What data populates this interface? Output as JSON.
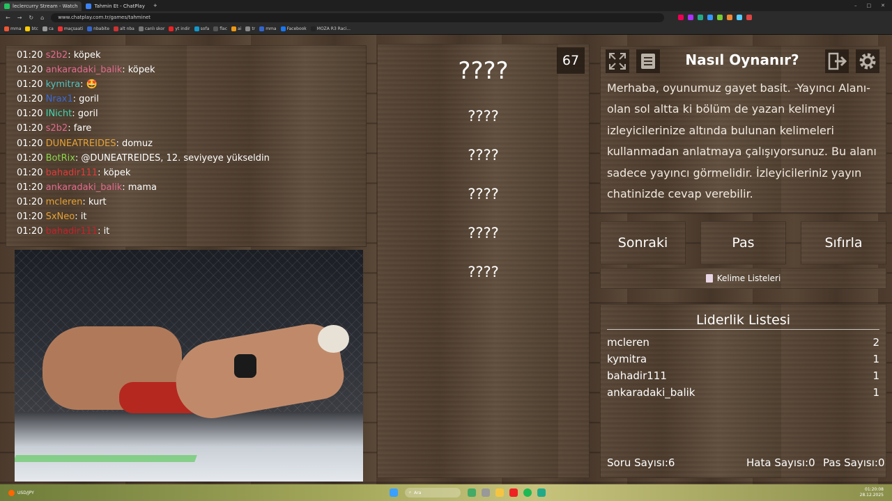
{
  "browser": {
    "tabs": [
      {
        "label": "leclercurry Stream - Watch",
        "active": true,
        "color": "#22c55e"
      },
      {
        "label": "Tahmin Et - ChatPlay",
        "active": false,
        "color": "#3b82f6"
      }
    ],
    "url": "www.chatplay.com.tr/games/tahminet",
    "bookmarks": [
      "mma",
      "btc",
      "ca",
      "maçsaati",
      "nbabite",
      "alt nba",
      "canlı skor",
      "yt indir",
      "sofa",
      "flac",
      "ai",
      "tr",
      "mma",
      "Facebook",
      "MOZA R3 Raci..."
    ]
  },
  "chat": {
    "messages": [
      {
        "time": "01:20",
        "user": "s2b2",
        "color": "#e36b8f",
        "text": ": köpek"
      },
      {
        "time": "01:20",
        "user": "ankaradaki_balik",
        "color": "#e36b8f",
        "text": ": köpek"
      },
      {
        "time": "01:20",
        "user": "kymitra",
        "color": "#4fc3c3",
        "text": ": 🤩"
      },
      {
        "time": "01:20",
        "user": "Nrax1",
        "color": "#3a6ad6",
        "text": ": goril"
      },
      {
        "time": "01:20",
        "user": "INicht",
        "color": "#3fd8b0",
        "text": ": goril"
      },
      {
        "time": "01:20",
        "user": "s2b2",
        "color": "#e36b8f",
        "text": ": fare"
      },
      {
        "time": "01:20",
        "user": "DUNEATREIDES",
        "color": "#e6a236",
        "text": ": domuz"
      },
      {
        "time": "01:20",
        "user": "BotRix",
        "color": "#8bd64a",
        "text": ": @DUNEATREIDES, 12. seviyeye yükseldin"
      },
      {
        "time": "01:20",
        "user": "bahadir111",
        "color": "#e23a3a",
        "text": ": köpek"
      },
      {
        "time": "01:20",
        "user": "ankaradaki_balik",
        "color": "#e36b8f",
        "text": ": mama"
      },
      {
        "time": "01:20",
        "user": "mcleren",
        "color": "#e6a236",
        "text": ": kurt"
      },
      {
        "time": "01:20",
        "user": "SxNeo",
        "color": "#e6a236",
        "text": ": it"
      },
      {
        "time": "01:20",
        "user": "bahadir111",
        "color": "#c2222b",
        "text": ": it"
      }
    ]
  },
  "game": {
    "counter": "67",
    "words": [
      "????",
      "????",
      "????",
      "????",
      "????",
      "????"
    ],
    "howto_title": "Nasıl Oynanır?",
    "howto_text": "Merhaba, oyunumuz gayet basit. -Yayıncı Alanı- olan sol altta ki bölüm de yazan kelimeyi izleyicilerinize altında bulunan kelimeleri kullanmadan anlatmaya çalışıyorsunuz. Bu alanı sadece yayıncı görmelidir. İzleyicileriniz yayın chatinizde cevap verebilir.",
    "buttons": {
      "next": "Sonraki",
      "pass": "Pas",
      "reset": "Sıfırla"
    },
    "word_lists": "Kelime Listeleri",
    "leaderboard": {
      "title": "Liderlik Listesi",
      "rows": [
        {
          "name": "mcleren",
          "score": "2"
        },
        {
          "name": "kymitra",
          "score": "1"
        },
        {
          "name": "bahadir111",
          "score": "1"
        },
        {
          "name": "ankaradaki_balik",
          "score": "1"
        }
      ]
    },
    "stats": {
      "questions": "Soru Sayısı:6",
      "errors": "Hata Sayısı:0",
      "passes": "Pas Sayısı:0"
    }
  },
  "taskbar": {
    "weather": "USD/JPY",
    "search_placeholder": "Ara",
    "time": "01:20:08",
    "date": "28.12.2025"
  }
}
